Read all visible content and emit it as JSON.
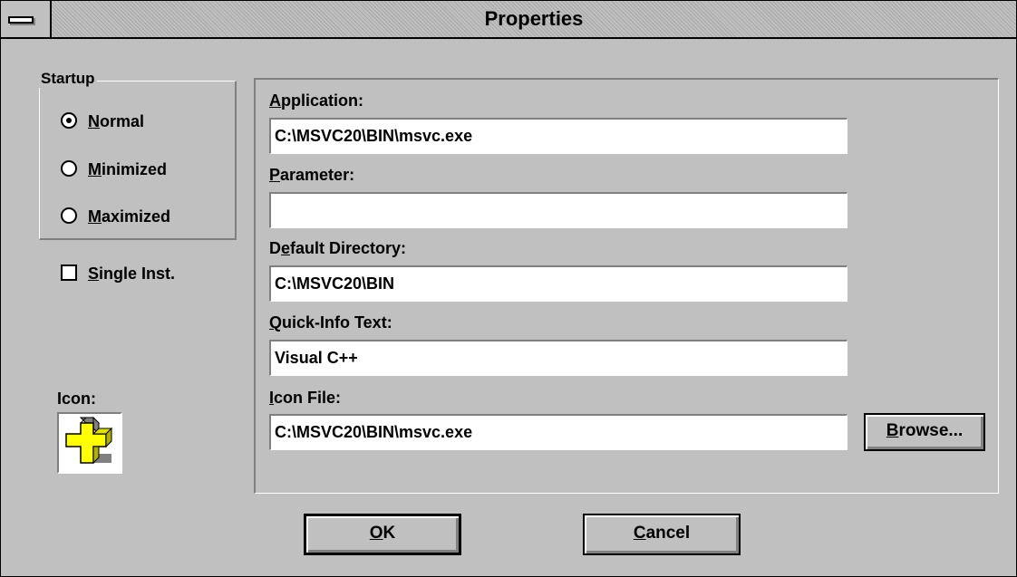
{
  "window": {
    "title": "Properties"
  },
  "startup": {
    "legend": "Startup",
    "options": [
      {
        "pre": "",
        "mn": "N",
        "post": "ormal",
        "selected": true
      },
      {
        "pre": "",
        "mn": "M",
        "post": "inimized",
        "selected": false
      },
      {
        "pre": "",
        "mn": "M",
        "post": "aximized",
        "selected": false
      }
    ]
  },
  "single_inst": {
    "pre": "",
    "mn": "S",
    "post": "ingle Inst.",
    "checked": false
  },
  "icon": {
    "label": "Icon:",
    "image": "visual-cpp-icon"
  },
  "fields": {
    "application": {
      "pre": "",
      "mn": "A",
      "post": "pplication:",
      "value": "C:\\MSVC20\\BIN\\msvc.exe"
    },
    "parameter": {
      "pre": "",
      "mn": "P",
      "post": "arameter:",
      "value": ""
    },
    "default_dir": {
      "pre": "D",
      "mn": "e",
      "post": "fault Directory:",
      "value": "C:\\MSVC20\\BIN"
    },
    "quick_info": {
      "pre": "",
      "mn": "Q",
      "post": "uick-Info Text:",
      "value": "Visual C++"
    },
    "icon_file": {
      "pre": "",
      "mn": "I",
      "post": "con File:",
      "value": "C:\\MSVC20\\BIN\\msvc.exe"
    }
  },
  "buttons": {
    "browse": {
      "pre": "",
      "mn": "B",
      "post": "rowse..."
    },
    "ok": {
      "pre": "",
      "mn": "O",
      "post": "K"
    },
    "cancel": {
      "pre": "",
      "mn": "C",
      "post": "ancel"
    }
  },
  "colors": {
    "face": "#c0c0c0",
    "shadow": "#808080",
    "highlight": "#ffffff",
    "icon_yellow": "#ffff00"
  }
}
